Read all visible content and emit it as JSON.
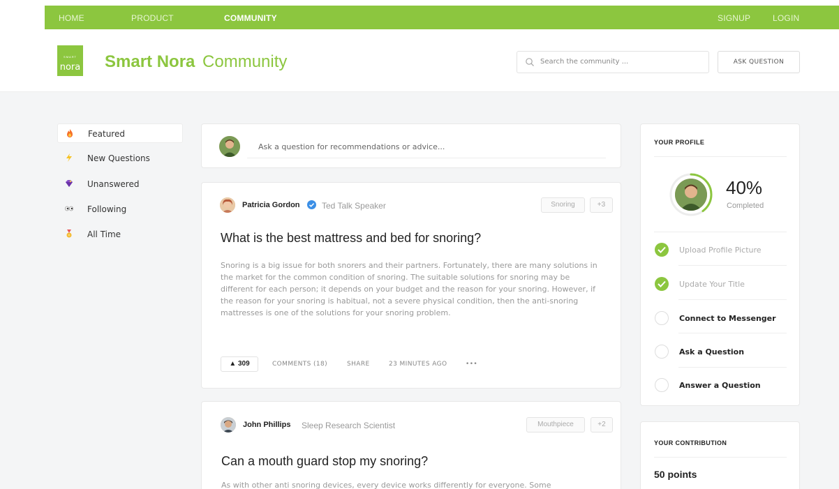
{
  "nav": {
    "home": "HOME",
    "product": "PRODUCT",
    "community": "COMMUNITY",
    "signup": "SIGNUP",
    "login": "LOGIN"
  },
  "brand": {
    "logo_small": "SMART",
    "logo_text": "nora",
    "name_bold": "Smart Nora",
    "name_light": "Community",
    "color": "#8cc63f"
  },
  "search": {
    "placeholder": "Search the community ..."
  },
  "ask_button": "ASK QUESTION",
  "sidebar": {
    "items": [
      {
        "icon": "fire-icon",
        "label": "Featured"
      },
      {
        "icon": "lightning-icon",
        "label": "New Questions"
      },
      {
        "icon": "gem-icon",
        "label": "Unanswered"
      },
      {
        "icon": "eyes-icon",
        "label": "Following"
      },
      {
        "icon": "medal-icon",
        "label": "All Time"
      }
    ]
  },
  "ask_box": {
    "placeholder": "Ask a question for recommendations or advice..."
  },
  "posts": [
    {
      "author": "Patricia Gordon",
      "verified": true,
      "role": "Ted Talk Speaker",
      "tag": "Snoring",
      "tag_more": "+3",
      "title": "What is the best mattress and bed for snoring?",
      "body": "Snoring is a big issue for both snorers and their partners. Fortunately, there are many solutions in the market for the common condition of snoring. The suitable solutions for snoring may be different for each person; it depends on your budget and the reason for your snoring. However, if the reason for your snoring is habitual, not a severe physical condition, then the anti-snoring mattresses is one of the solutions for your snoring problem.",
      "votes": "▲ 309",
      "comments": "COMMENTS (18)",
      "share": "SHARE",
      "time": "23 MINUTES AGO",
      "more": "•••"
    },
    {
      "author": "John Phillips",
      "role": "Sleep Research Scientist",
      "tag": "Mouthpiece",
      "tag_more": "+2",
      "title": "Can a mouth guard stop my snoring?",
      "body": "As with other anti snoring devices, every device works differently for everyone. Some"
    }
  ],
  "profile": {
    "title": "YOUR PROFILE",
    "percent": "40%",
    "percent_label": "Completed",
    "progress": 0.4,
    "tasks": [
      {
        "label": "Upload Profile Picture",
        "done": true
      },
      {
        "label": "Update Your Title",
        "done": true
      },
      {
        "label": "Connect to Messenger",
        "done": false
      },
      {
        "label": "Ask a Question",
        "done": false
      },
      {
        "label": "Answer a Question",
        "done": false
      }
    ]
  },
  "contribution": {
    "title": "YOUR CONTRIBUTION",
    "points": "50 points"
  }
}
